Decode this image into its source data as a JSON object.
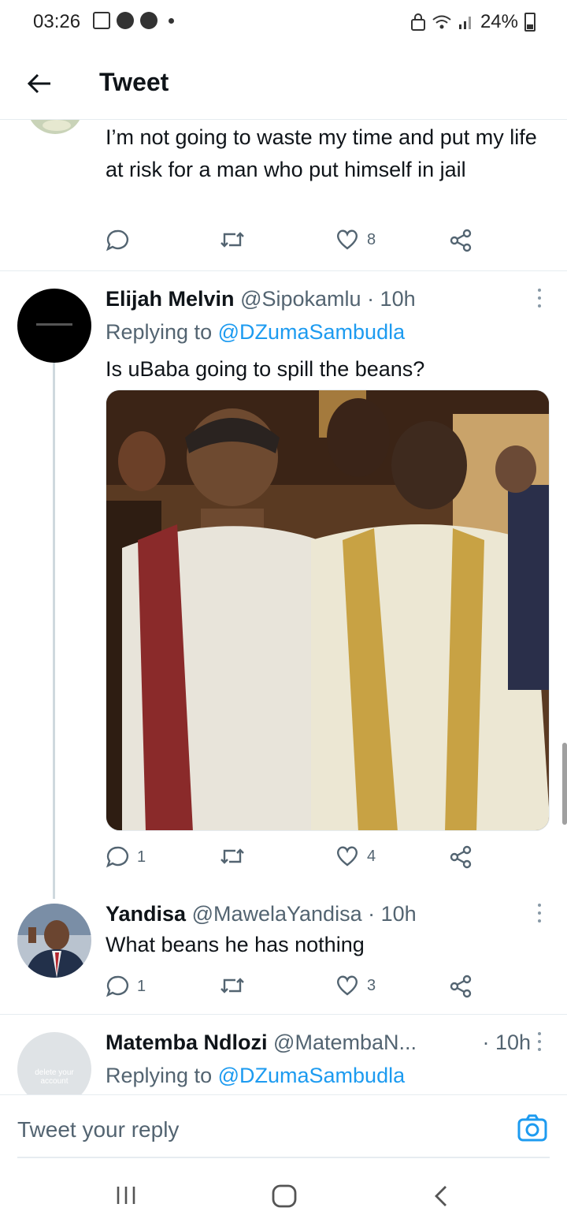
{
  "status_bar": {
    "time": "03:26",
    "battery": "24%"
  },
  "header": {
    "title": "Tweet"
  },
  "tweets": [
    {
      "text": "I’m not going to waste my time and put my life at risk for a man who put himself in jail",
      "likes": "8"
    },
    {
      "name": "Elijah Melvin",
      "handle": "@Sipokamlu",
      "time": "· 10h",
      "replying_prefix": "Replying to ",
      "replying_to": "@DZumaSambudla",
      "text": "Is uBaba going to spill the beans?",
      "replies": "1",
      "likes": "4"
    },
    {
      "name": "Yandisa",
      "handle": "@MawelaYandisa",
      "time": "· 10h",
      "text": "What beans he has nothing",
      "replies": "1",
      "likes": "3"
    },
    {
      "name": "Matemba Ndlozi",
      "handle": "@MatembaN...",
      "time": "· 10h",
      "replying_prefix": "Replying to ",
      "replying_to": "@DZumaSambudla",
      "avatar_text": "delete your account"
    }
  ],
  "reply_box": {
    "placeholder": "Tweet your reply"
  },
  "icons": {
    "back": "arrow-left-icon",
    "reply": "comment-bubble-icon",
    "retweet": "retweet-icon",
    "like": "heart-icon",
    "share": "share-icon",
    "camera": "camera-icon",
    "more": "more-vertical-icon"
  },
  "colors": {
    "accent": "#1d9bf0",
    "text": "#0f1419",
    "muted": "#536471"
  }
}
